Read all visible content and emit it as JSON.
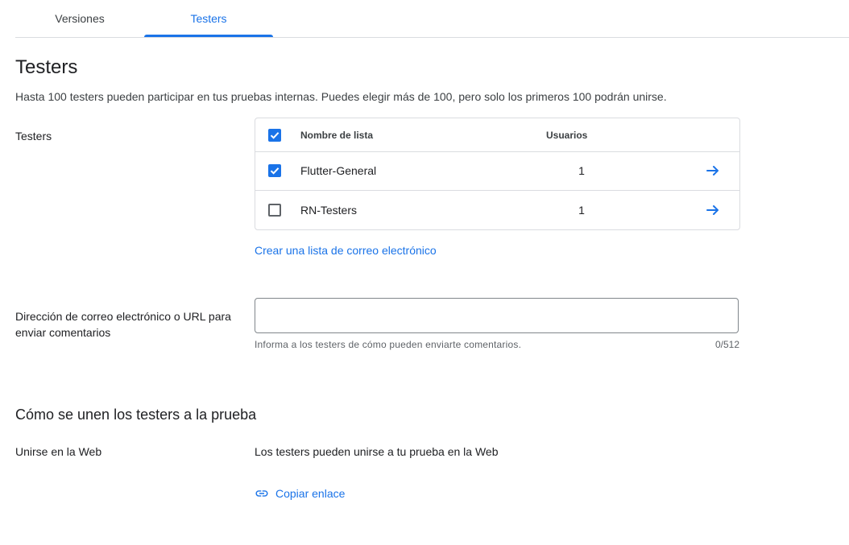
{
  "tabs": [
    {
      "label": "Versiones",
      "active": false
    },
    {
      "label": "Testers",
      "active": true
    }
  ],
  "page": {
    "title": "Testers",
    "description": "Hasta 100 testers pueden participar en tus pruebas internas. Puedes elegir más de 100, pero solo los primeros 100 podrán unirse."
  },
  "testers_section": {
    "label": "Testers",
    "table": {
      "header": {
        "name": "Nombre de lista",
        "users": "Usuarios",
        "checked": true
      },
      "rows": [
        {
          "name": "Flutter-General",
          "users": "1",
          "checked": true
        },
        {
          "name": "RN-Testers",
          "users": "1",
          "checked": false
        }
      ]
    },
    "create_list_link": "Crear una lista de correo electrónico"
  },
  "feedback": {
    "label": "Dirección de correo electrónico o URL para enviar comentarios",
    "value": "",
    "hint": "Informa a los testers de cómo pueden enviarte comentarios.",
    "counter": "0/512"
  },
  "join": {
    "title": "Cómo se unen los testers a la prueba",
    "web_label": "Unirse en la Web",
    "web_text": "Los testers pueden unirse a tu prueba en la Web",
    "copy_link": "Copiar enlace"
  },
  "colors": {
    "accent": "#1a73e8",
    "border": "#dadce0",
    "text": "#202124"
  }
}
